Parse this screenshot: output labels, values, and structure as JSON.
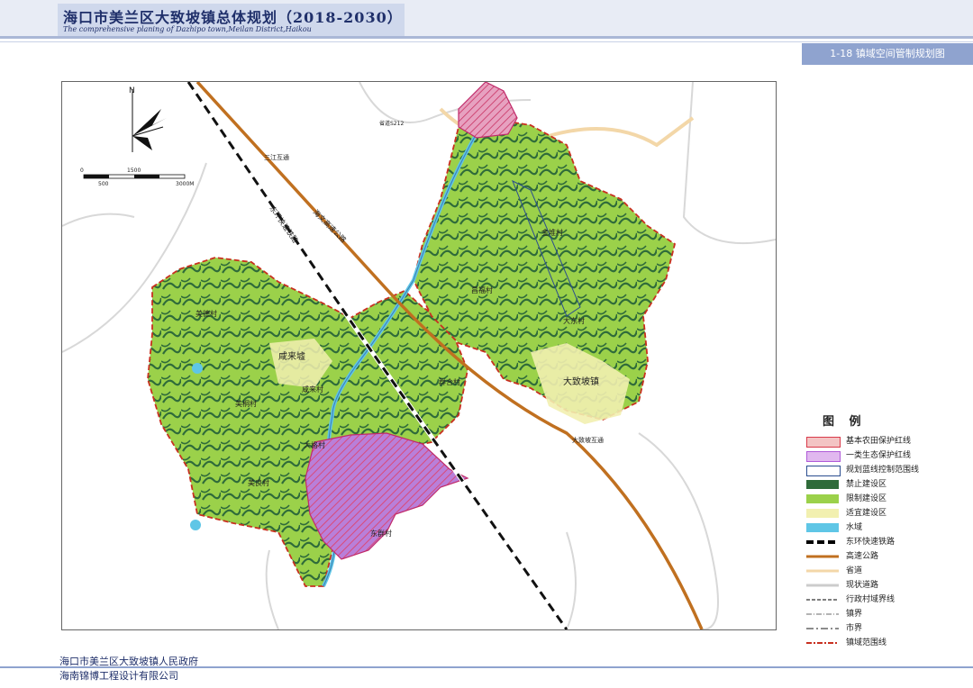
{
  "header": {
    "title": "海口市美兰区大致坡镇总体规划（2018-2030）",
    "subtitle": "The comprehensive planing of Dazhipo town,Meilan District,Haikou",
    "sheet": "1-18 镇域空间管制规划图"
  },
  "map": {
    "north_label": "N",
    "scale_numbers": [
      "0",
      "1500",
      "500",
      "3000M"
    ],
    "roads": {
      "expressway_rail": "东环快速铁路",
      "highway": "海文高速公路",
      "interchange1": "三江互通",
      "interchange2": "大致坡互通",
      "road_s": "省道S212"
    },
    "places": {
      "town": "大致坡镇",
      "villages": [
        "金堆村",
        "昌福村",
        "大东村",
        "咸来墟",
        "咸来村",
        "美桐村",
        "群合村",
        "大格村",
        "美良村",
        "东群村",
        "美德村"
      ]
    },
    "colors": {
      "farmland_red": "#d93a4a",
      "eco_purple": "#b05cd8",
      "forbidden": "#2f6b3a",
      "restricted": "#9bd14a",
      "suitable": "#f2f0b0",
      "water": "#5fc6e6",
      "highway": "#c07020"
    }
  },
  "legend": {
    "title": "图 例",
    "items": [
      {
        "label": "基本农田保护红线",
        "color": "#f3c4c4",
        "icon": "farmland-red-line"
      },
      {
        "label": "一类生态保护红线",
        "color": "#e1b8ef",
        "icon": "eco-red-line"
      },
      {
        "label": "规划蓝线控制范围线",
        "color": "#ffffff",
        "icon": "blue-line-box"
      },
      {
        "label": "禁止建设区",
        "color": "#2f6b3a",
        "icon": "forbidden-zone"
      },
      {
        "label": "限制建设区",
        "color": "#9bd14a",
        "icon": "restricted-zone"
      },
      {
        "label": "适宜建设区",
        "color": "#f2f0b0",
        "icon": "suitable-zone"
      },
      {
        "label": "水域",
        "color": "#5fc6e6",
        "icon": "water"
      },
      {
        "label": "东环快速铁路",
        "color": "#000000",
        "icon": "railway-line"
      },
      {
        "label": "高速公路",
        "color": "#c07020",
        "icon": "highway-line"
      },
      {
        "label": "省道",
        "color": "#f3d7a8",
        "icon": "provincial-road-line"
      },
      {
        "label": "现状道路",
        "color": "#cccccc",
        "icon": "existing-road-line"
      },
      {
        "label": "行政村域界线",
        "color": "#555555",
        "icon": "village-boundary-line"
      },
      {
        "label": "镇界",
        "color": "#888888",
        "icon": "town-boundary-line"
      },
      {
        "label": "市界",
        "color": "#666666",
        "icon": "city-boundary-line"
      },
      {
        "label": "镇域范围线",
        "color": "#c83020",
        "icon": "township-boundary-line"
      }
    ]
  },
  "footer": {
    "org1": "海口市美兰区大致坡镇人民政府",
    "org2": "海南锦博工程设计有限公司"
  }
}
